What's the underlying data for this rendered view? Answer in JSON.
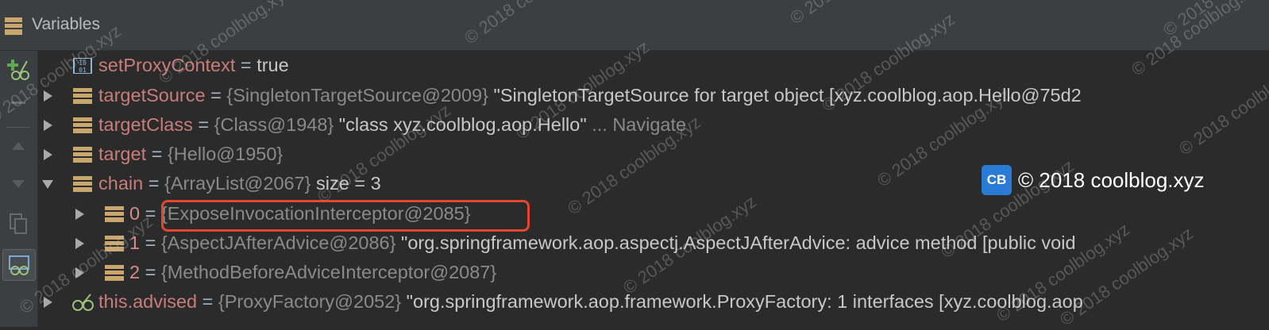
{
  "panel": {
    "title": "Variables"
  },
  "rows": [
    {
      "name": "setProxyContext",
      "eq": " = ",
      "type": "",
      "value": "true",
      "nav": ""
    },
    {
      "name": "targetSource",
      "eq": " = ",
      "type": "{SingletonTargetSource@2009}",
      "value": " \"SingletonTargetSource for target object [xyz.coolblog.aop.Hello@75d2",
      "nav": ""
    },
    {
      "name": "targetClass",
      "eq": " = ",
      "type": "{Class@1948}",
      "value": " \"class xyz.coolblog.aop.Hello\"",
      "nav": " ... Navigate"
    },
    {
      "name": "target",
      "eq": " = ",
      "type": "{Hello@1950}",
      "value": "",
      "nav": ""
    },
    {
      "name": "chain",
      "eq": " = ",
      "type": "{ArrayList@2067}",
      "value": "  size = 3",
      "nav": ""
    },
    {
      "name": "0",
      "eq": " = ",
      "type": "{ExposeInvocationInterceptor@2085}",
      "value": "",
      "nav": ""
    },
    {
      "name": "1",
      "eq": " = ",
      "type": "{AspectJAfterAdvice@2086}",
      "value": " \"org.springframework.aop.aspectj.AspectJAfterAdvice: advice method [public void",
      "nav": ""
    },
    {
      "name": "2",
      "eq": " = ",
      "type": "{MethodBeforeAdviceInterceptor@2087}",
      "value": "",
      "nav": ""
    },
    {
      "name": "this.advised",
      "eq": " = ",
      "type": "{ProxyFactory@2052}",
      "value": " \"org.springframework.aop.framework.ProxyFactory: 1 interfaces [xyz.coolblog.aop",
      "nav": ""
    }
  ],
  "watermark": {
    "text": "© 2018 coolblog.xyz",
    "badge_logo": "CB",
    "badge_text": "© 2018 coolblog.xyz"
  },
  "icons": {
    "header": "variables-grid-icon",
    "primitive": "binary-icon",
    "object": "object-fields-icon",
    "watch": "watch-glasses-icon"
  },
  "colors": {
    "background": "#2b2b2b",
    "name": "#c97d7a",
    "highlight": "#e8452f",
    "badge": "#2a7bd6"
  }
}
